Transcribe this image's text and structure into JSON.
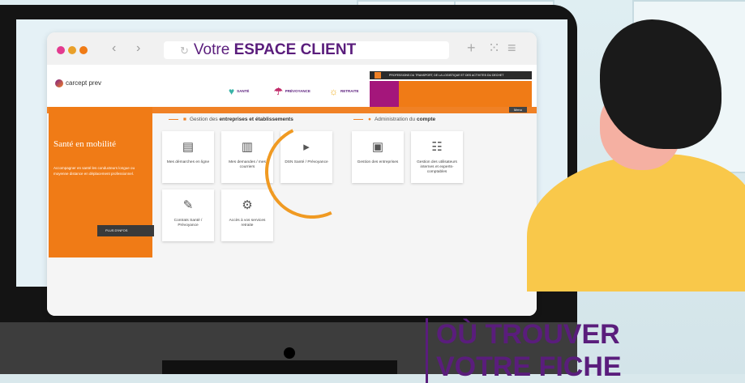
{
  "browser": {
    "url_prefix": "Votre",
    "url_emphasis": "ESPACE CLIENT",
    "reload_icon": "reload-icon",
    "back_icon": "chevron-left-icon",
    "forward_icon": "chevron-right-icon",
    "colors": {
      "red": "#ff5f57",
      "yellow": "#ffbd2e",
      "green": "#28c840"
    }
  },
  "site": {
    "logo_text": "carcept prev",
    "top_strip": "PROFESSIONS DU TRANSPORT, DE LA LOGISTIQUE ET DES ACTIVITES DU DECHET",
    "menu": [
      {
        "label": "SANTÉ",
        "icon": "heart-icon"
      },
      {
        "label": "PRÉVOYANCE",
        "icon": "umbrella-icon"
      },
      {
        "label": "RETRAITE",
        "icon": "sun-icon"
      }
    ],
    "submenu": "Menu",
    "sidebar": {
      "title": "Santé en mobilité",
      "text": "Accompagner en santé les conducteurs longue ou moyenne distance en déplacement professionnel.",
      "more": "PLUS D'INFOS"
    },
    "section_left": {
      "prefix": "Gestion des",
      "emphasis": "entreprises et établissements"
    },
    "section_right": {
      "prefix": "Administration du",
      "emphasis": "compte"
    },
    "tiles": [
      {
        "label": "Mes démarches en ligne",
        "icon": "computer-icon"
      },
      {
        "label": "Mes demandes / mes courriers",
        "icon": "documents-icon"
      },
      {
        "label": "DSN Santé / Prévoyance",
        "icon": "dsn-icon"
      },
      {
        "label": "Gestion des entreprises",
        "icon": "building-icon"
      },
      {
        "label": "Gestion des utilisateurs internes et experts-comptables",
        "icon": "users-icon"
      },
      {
        "label": "Contrats Santé / Prévoyance",
        "icon": "pen-icon"
      },
      {
        "label": "Accès à vos services retraite",
        "icon": "network-icon"
      }
    ]
  },
  "headline": {
    "line1": "OÙ TROUVER",
    "line2": "VOTRE FICHE"
  }
}
